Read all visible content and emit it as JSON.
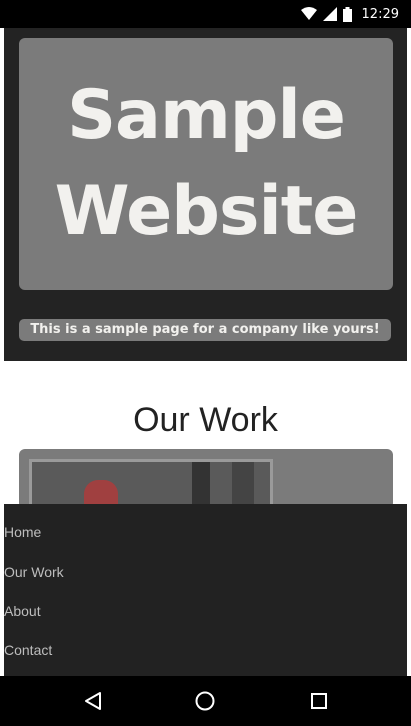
{
  "status_bar": {
    "time": "12:29",
    "icons": [
      "wifi-icon",
      "signal-icon",
      "battery-icon"
    ]
  },
  "hero": {
    "title_line1": "Sample",
    "title_line2": "Website",
    "tagline": "This is a sample page for a company like yours!"
  },
  "work": {
    "heading": "Our Work"
  },
  "nav": {
    "items": [
      {
        "label": "Home"
      },
      {
        "label": "Our Work"
      },
      {
        "label": "About"
      },
      {
        "label": "Contact"
      }
    ]
  },
  "system_nav": {
    "buttons": [
      "back-icon",
      "home-icon",
      "recents-icon"
    ]
  }
}
